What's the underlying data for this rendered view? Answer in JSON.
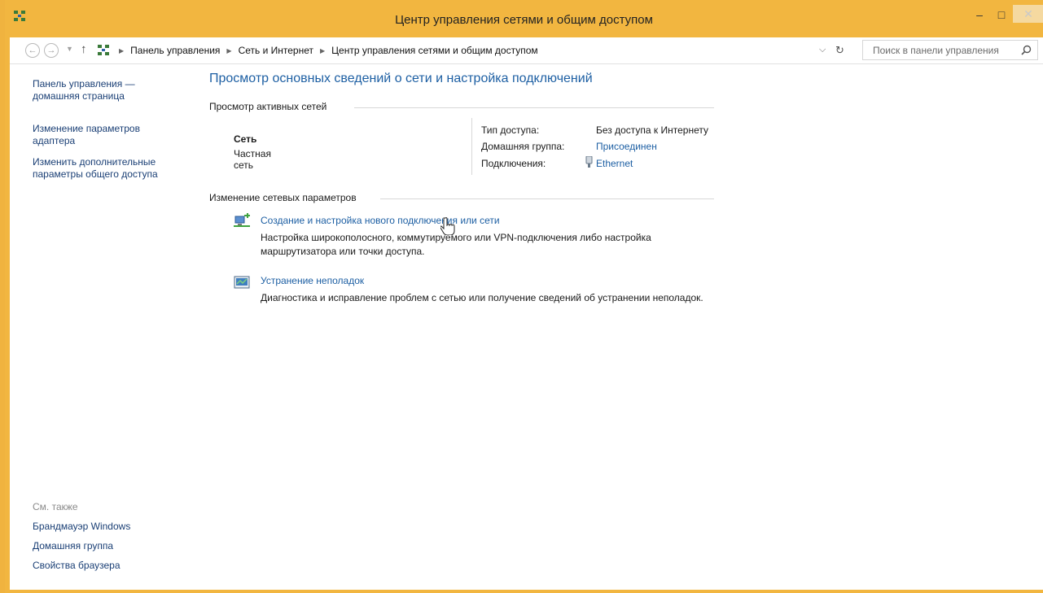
{
  "window": {
    "title": "Центр управления сетями и общим доступом",
    "accent": "#f2b640",
    "minimize_glyph": "–",
    "maximize_glyph": "□",
    "close_glyph": "✕"
  },
  "address_bar": {
    "breadcrumbs": [
      "Панель управления",
      "Сеть и Интернет",
      "Центр управления сетями и общим доступом"
    ],
    "search_placeholder": "Поиск в панели управления"
  },
  "sidebar": {
    "home_link": [
      "Панель управления —",
      "домашняя страница"
    ],
    "adapter_link": [
      "Изменение параметров",
      "адаптера"
    ],
    "sharing_link": [
      "Изменить дополнительные",
      "параметры общего доступа"
    ],
    "see_also": "См. также",
    "see_also_links": [
      "Брандмауэр Windows",
      "Домашняя группа",
      "Свойства браузера"
    ]
  },
  "main": {
    "page_title": "Просмотр основных сведений о сети и настройка подключений",
    "active_networks_header": "Просмотр активных сетей",
    "network": {
      "name": "Сеть",
      "type": "Частная сеть",
      "access_label": "Тип доступа:",
      "access_value": "Без доступа к Интернету",
      "homegroup_label": "Домашняя группа:",
      "homegroup_value": "Присоединен",
      "connections_label": "Подключения:",
      "connections_value": "Ethernet"
    },
    "change_settings_header": "Изменение сетевых параметров",
    "tasks": [
      {
        "link": "Создание и настройка нового подключения или сети",
        "desc": "Настройка широкополосного, коммутируемого или VPN-подключения либо настройка маршрутизатора или точки доступа."
      },
      {
        "link": "Устранение неполадок",
        "desc": "Диагностика и исправление проблем с сетью или получение сведений об устранении неполадок."
      }
    ]
  },
  "colors": {
    "link": "#1d5fa3",
    "nav_link": "#1a3f75",
    "title_bar": "#f2b640"
  }
}
